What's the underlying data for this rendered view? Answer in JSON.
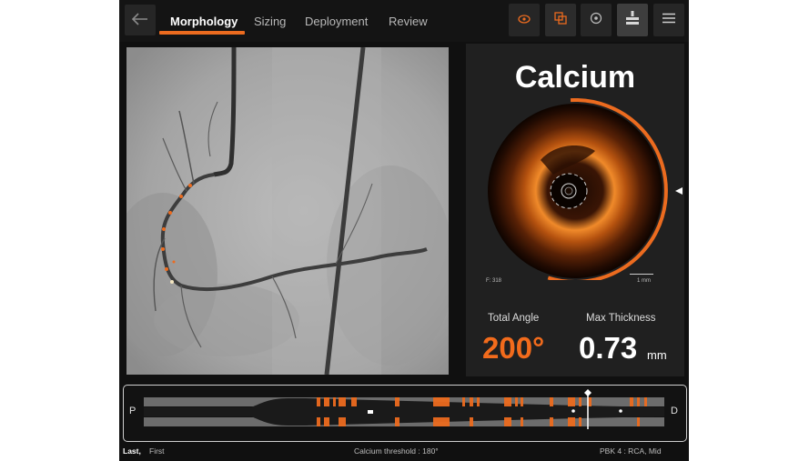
{
  "tabs": [
    {
      "label": "Morphology",
      "active": true
    },
    {
      "label": "Sizing",
      "active": false
    },
    {
      "label": "Deployment",
      "active": false
    },
    {
      "label": "Review",
      "active": false
    }
  ],
  "icons": {
    "back": "back-arrow-icon",
    "tools": [
      "eye-icon",
      "layers-icon",
      "target-icon",
      "stent-icon",
      "menu-icon"
    ]
  },
  "colors": {
    "accent": "#ec6b1f",
    "panel": "#202020",
    "background": "#101010"
  },
  "calcium": {
    "title": "Calcium",
    "frame_label": "F: 318",
    "scale_label": "1 mm",
    "total_angle_label": "Total Angle",
    "total_angle_value": "200°",
    "max_thickness_label": "Max Thickness",
    "max_thickness_value": "0.73",
    "max_thickness_unit": "mm",
    "arc_fraction": 0.556
  },
  "strip": {
    "proximal_label": "P",
    "distal_label": "D"
  },
  "footer": {
    "last": "Last,",
    "first": "First",
    "threshold": "Calcium threshold : 180°",
    "location": "PBK 4 : RCA, Mid"
  }
}
